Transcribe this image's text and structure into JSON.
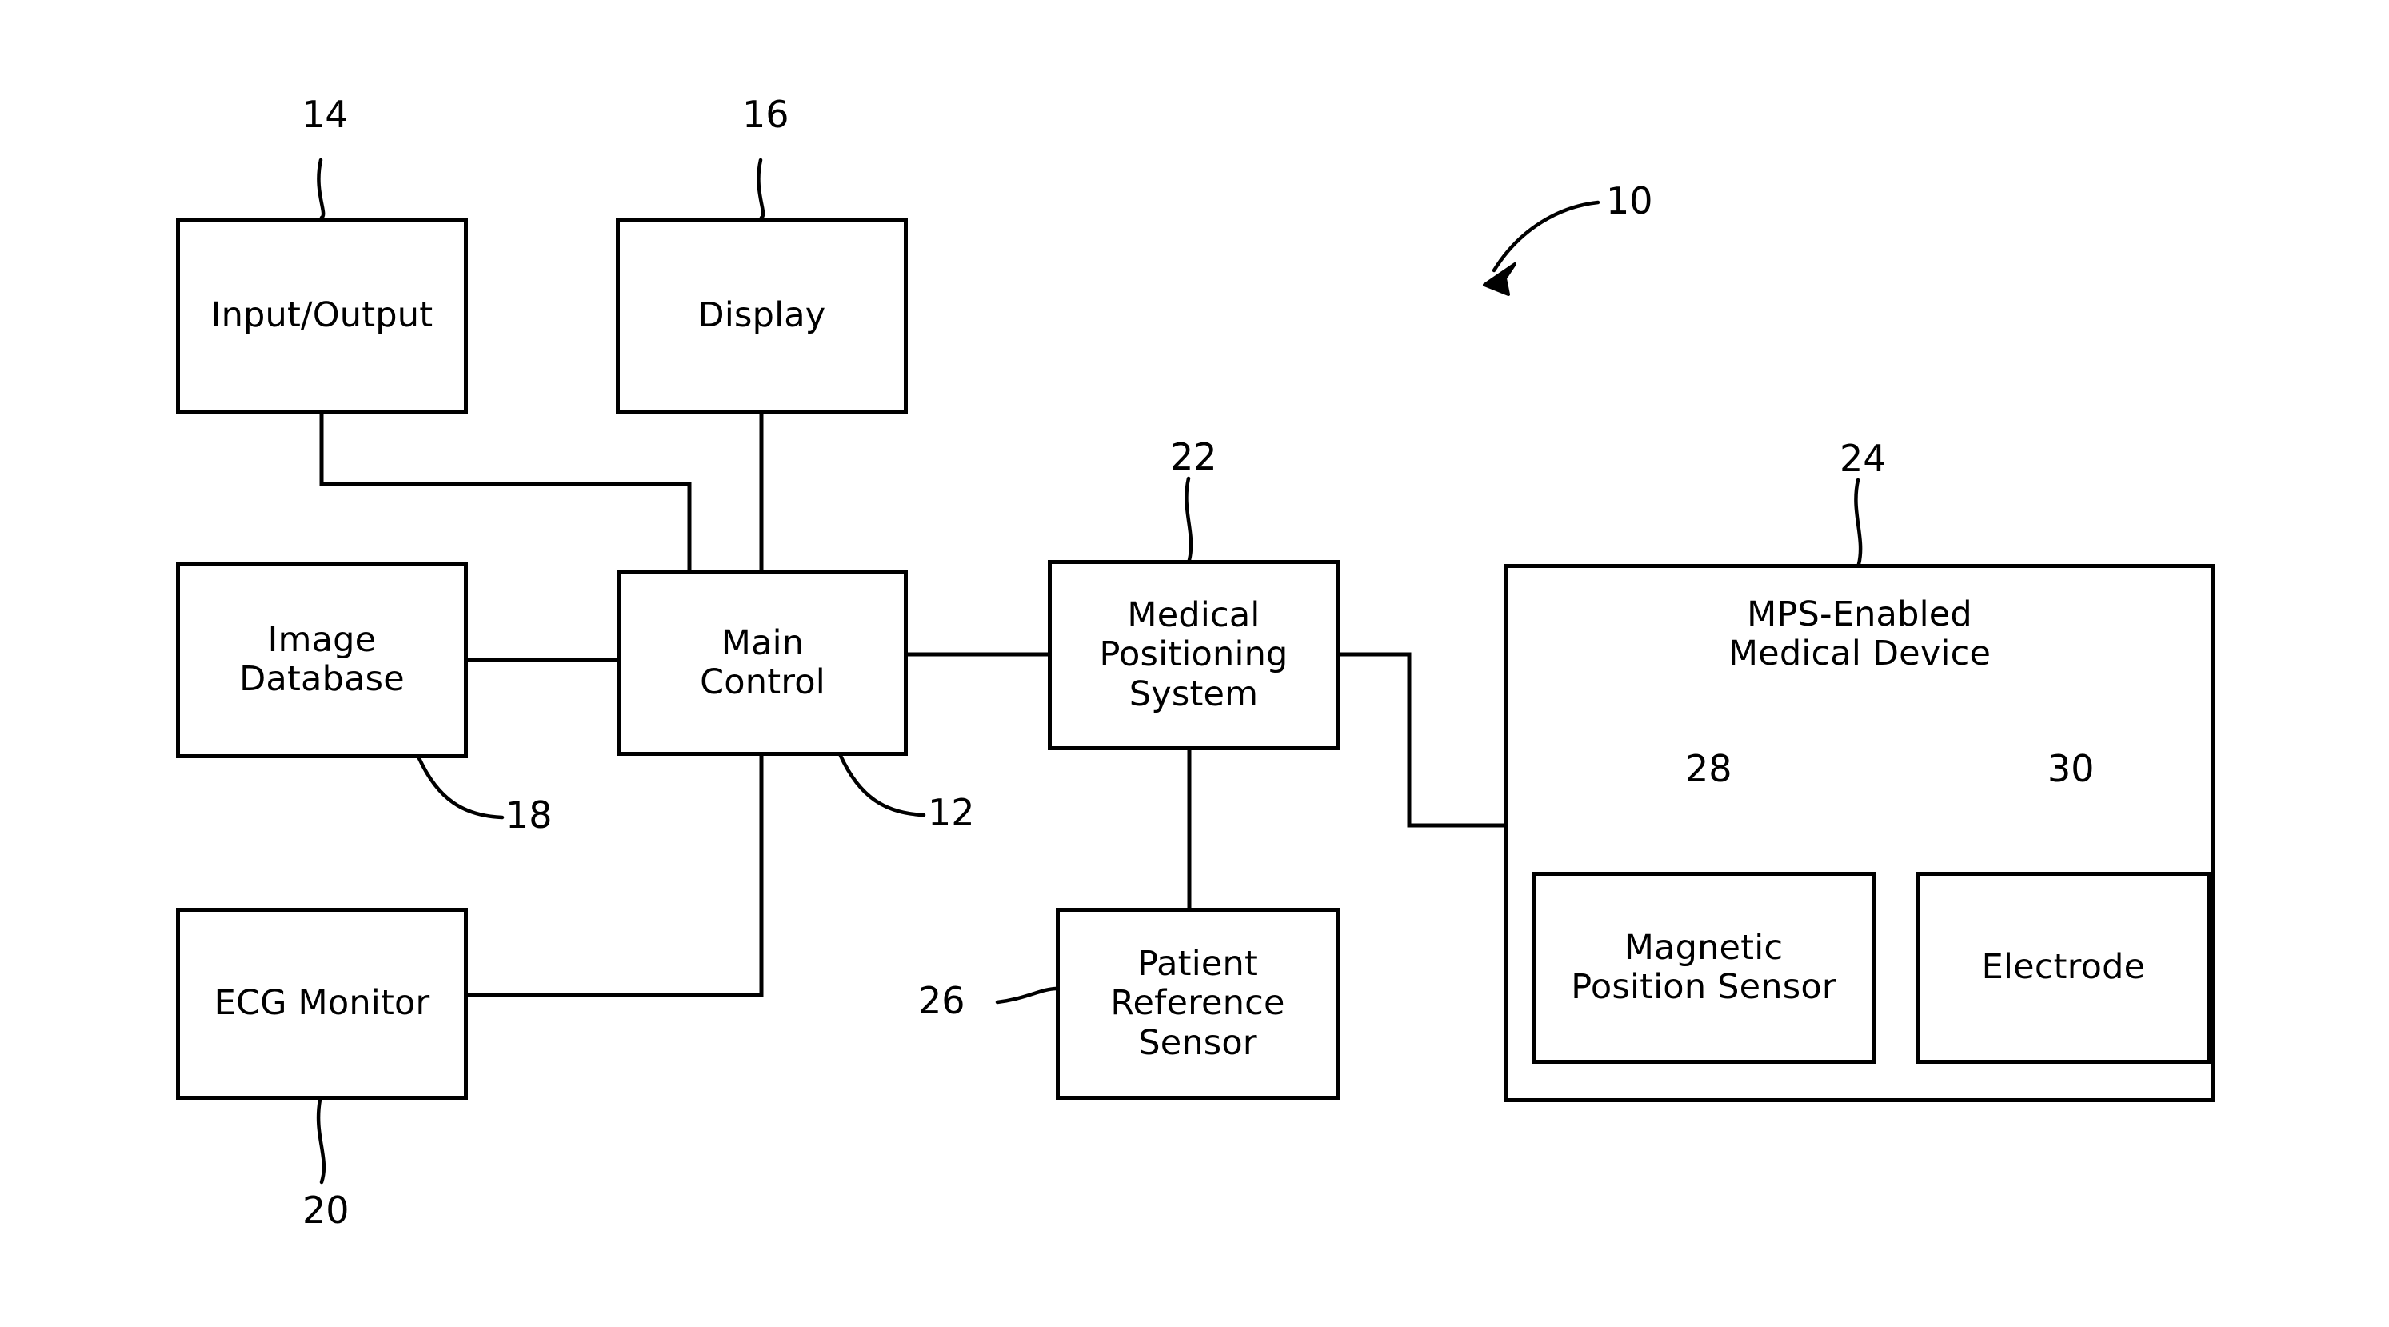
{
  "figure": {
    "type": "patent-block-diagram",
    "system_reference_numeral": "10",
    "background_color": "#ffffff",
    "line_color": "#000000"
  },
  "blocks": {
    "input_output": {
      "label": "Input/Output",
      "ref": "14"
    },
    "display": {
      "label": "Display",
      "ref": "16"
    },
    "image_database": {
      "label": "Image\nDatabase",
      "ref": "18"
    },
    "main_control": {
      "label": "Main\nControl",
      "ref": "12"
    },
    "ecg_monitor": {
      "label": "ECG Monitor",
      "ref": "20"
    },
    "medical_positioning_system": {
      "label": "Medical\nPositioning\nSystem",
      "ref": "22"
    },
    "patient_reference_sensor": {
      "label": "Patient\nReference\nSensor",
      "ref": "26"
    },
    "mps_enabled_medical_device": {
      "label": "MPS-Enabled\nMedical Device",
      "ref": "24"
    },
    "magnetic_position_sensor": {
      "label": "Magnetic\nPosition Sensor",
      "ref": "28"
    },
    "electrode": {
      "label": "Electrode",
      "ref": "30"
    }
  }
}
